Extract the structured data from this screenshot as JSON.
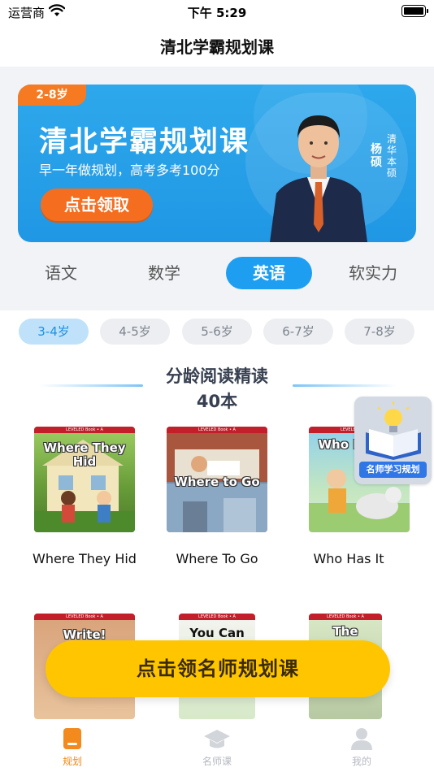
{
  "status_bar": {
    "carrier": "运营商",
    "time": "下午 5:29"
  },
  "nav": {
    "title": "清北学霸规划课"
  },
  "banner": {
    "age_badge": "2-8岁",
    "title": "清北学霸规划课",
    "subtitle": "早一年做规划，高考多考100分",
    "button_label": "点击领取",
    "presenter_name": "杨硕",
    "presenter_title": "清华本硕"
  },
  "subject_tabs": [
    {
      "label": "语文",
      "active": false
    },
    {
      "label": "数学",
      "active": false
    },
    {
      "label": "英语",
      "active": true
    },
    {
      "label": "软实力",
      "active": false
    }
  ],
  "age_filters": [
    {
      "label": "3-4岁",
      "active": true
    },
    {
      "label": "4-5岁",
      "active": false
    },
    {
      "label": "5-6岁",
      "active": false
    },
    {
      "label": "6-7岁",
      "active": false
    },
    {
      "label": "7-8岁",
      "active": false
    }
  ],
  "section": {
    "title": "分龄阅读精读",
    "count": "40本"
  },
  "books": [
    {
      "cover_title": "Where They Hid",
      "caption": "Where They Hid"
    },
    {
      "cover_title": "Where to Go",
      "caption": "Where To Go"
    },
    {
      "cover_title": "Who Has It?",
      "caption": "Who Has It"
    },
    {
      "cover_title": "Write!",
      "caption": ""
    },
    {
      "cover_title": "You Can",
      "caption": ""
    },
    {
      "cover_title": "The",
      "caption": ""
    }
  ],
  "cover_band_text": "LEVELED Book • A",
  "floating_badge": {
    "label": "名师学习规划"
  },
  "cta": {
    "label": "点击领名师规划课"
  },
  "tab_bar": [
    {
      "label": "规划",
      "icon": "book-icon",
      "active": true
    },
    {
      "label": "名师课",
      "icon": "graduation-cap-icon",
      "active": false
    },
    {
      "label": "我的",
      "icon": "person-icon",
      "active": false
    }
  ],
  "colors": {
    "brand_blue": "#1e9ef0",
    "orange": "#f56e1f",
    "cta_yellow": "#ffc600",
    "tab_active": "#f28a1d"
  }
}
